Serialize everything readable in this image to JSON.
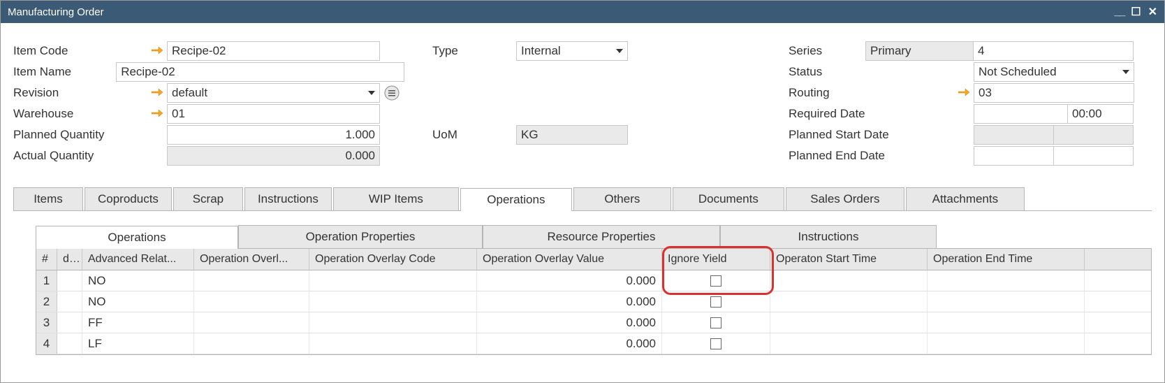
{
  "window": {
    "title": "Manufacturing Order"
  },
  "labels": {
    "item_code": "Item Code",
    "item_name": "Item Name",
    "revision": "Revision",
    "warehouse": "Warehouse",
    "planned_qty": "Planned Quantity",
    "actual_qty": "Actual Quantity",
    "type": "Type",
    "uom": "UoM",
    "series": "Series",
    "status": "Status",
    "routing": "Routing",
    "required_date": "Required Date",
    "planned_start": "Planned Start Date",
    "planned_end": "Planned End Date"
  },
  "fields": {
    "item_code": "Recipe-02",
    "item_name": "Recipe-02",
    "revision": "default",
    "warehouse": "01",
    "planned_qty": "1.000",
    "actual_qty": "0.000",
    "type": "Internal",
    "uom": "KG",
    "series": "Primary",
    "series_no": "4",
    "status": "Not Scheduled",
    "routing": "03",
    "required_date": "",
    "required_time": "00:00",
    "planned_start_date": "",
    "planned_start_time": "",
    "planned_end_date": "",
    "planned_end_time": ""
  },
  "tabs": {
    "items": "Items",
    "coproducts": "Coproducts",
    "scrap": "Scrap",
    "instructions": "Instructions",
    "wip": "WIP Items",
    "operations": "Operations",
    "others": "Others",
    "documents": "Documents",
    "sales_orders": "Sales Orders",
    "attachments": "Attachments"
  },
  "subtabs": {
    "operations": "Operations",
    "op_props": "Operation Properties",
    "res_props": "Resource Properties",
    "instructions": "Instructions"
  },
  "grid": {
    "headers": {
      "rownum": "#",
      "opcode": "d ...",
      "adv": "Advanced Relat...",
      "ovid": "Operation Overl...",
      "ovcode": "Operation Overlay Code",
      "ovval": "Operation Overlay Value",
      "ignore": "Ignore Yield",
      "start": "Operaton Start Time",
      "end": "Operation End Time"
    },
    "rows": [
      {
        "n": "1",
        "adv": "NO",
        "ovval": "0.000"
      },
      {
        "n": "2",
        "adv": "NO",
        "ovval": "0.000"
      },
      {
        "n": "3",
        "adv": "FF",
        "ovval": "0.000"
      },
      {
        "n": "4",
        "adv": "LF",
        "ovval": "0.000"
      }
    ]
  }
}
